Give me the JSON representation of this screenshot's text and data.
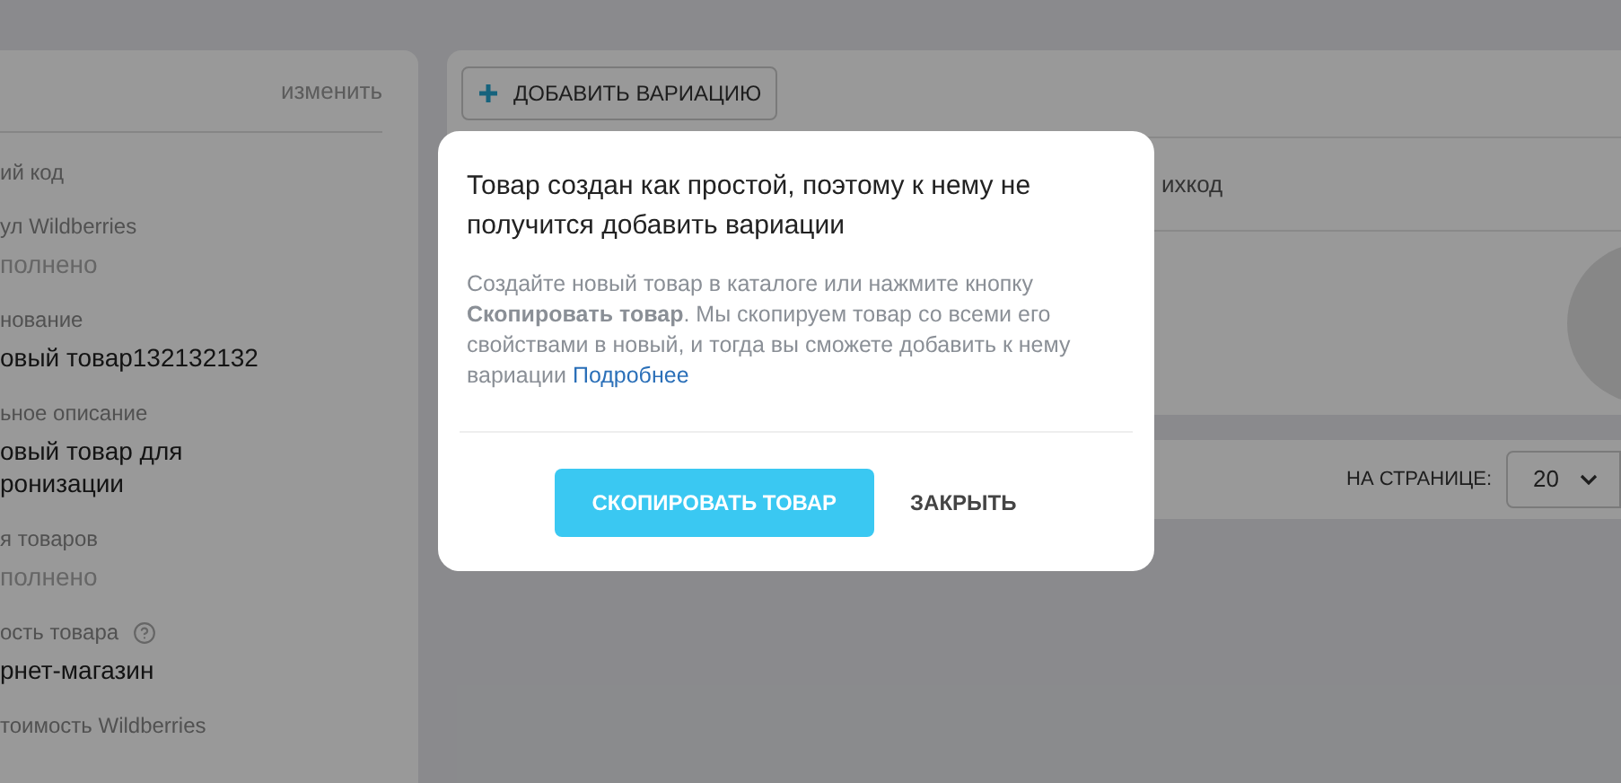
{
  "left_panel": {
    "edit_link": "изменить",
    "fields": [
      {
        "label": "ий код"
      },
      {
        "label": "ул Wildberries",
        "value": "полнено",
        "empty": true
      },
      {
        "label": "нование",
        "value": "овый товар132132132",
        "empty": false
      },
      {
        "label": "ьное описание",
        "value": "овый товар для ронизации",
        "empty": false
      },
      {
        "label": "я товаров",
        "value": "полнено",
        "empty": true
      },
      {
        "label": "ость товара",
        "value": "рнет-магазин",
        "empty": false,
        "help": true
      },
      {
        "label": "тоимость Wildberries"
      }
    ]
  },
  "main": {
    "add_variation_button": "ДОБАВИТЬ ВАРИАЦИЮ",
    "column_header": "ихкод",
    "per_page_label": "НА СТРАНИЦЕ:",
    "per_page_value": "20"
  },
  "dialog": {
    "title": "Товар создан как простой, поэтому к нему не получится добавить вариации",
    "body": "Создайте новый товар в каталоге или нажмите кнопку **Скопировать товар**. Мы скопируем товар со всеми его свойствами в новый, и тогда вы сможете добавить к нему вариации",
    "link": "Подробнее",
    "buttons": [
      {
        "label": "СКОПИРОВАТЬ ТОВАР",
        "kind": "primary"
      },
      {
        "label": "ЗАКРЫТЬ",
        "kind": "text"
      }
    ]
  }
}
